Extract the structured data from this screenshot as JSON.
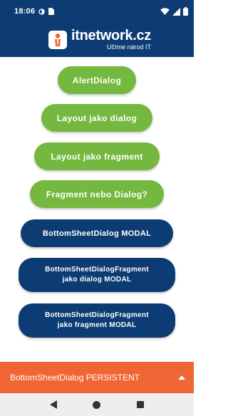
{
  "status_bar": {
    "time": "18:06",
    "icons": [
      "half-circle-icon",
      "sim-card-icon",
      "wifi-icon",
      "signal-icon",
      "battery-icon"
    ]
  },
  "app_bar": {
    "logo_name": "itnetwork.cz",
    "logo_tagline": "Učíme národ IT",
    "colors": {
      "background": "#0d3b73",
      "accent": "#ef6534"
    }
  },
  "buttons": [
    {
      "label": "AlertDialog"
    },
    {
      "label": "Layout jako dialog"
    },
    {
      "label": "Layout jako fragment"
    },
    {
      "label": "Fragment nebo Dialog?"
    },
    {
      "label": "BottomSheetDialog MODAL"
    },
    {
      "line1": "BottomSheetDialogFragment",
      "line2": "jako dialog MODAL"
    },
    {
      "line1": "BottomSheetDialogFragment",
      "line2": "jako fragment MODAL"
    }
  ],
  "button_colors": {
    "green": "#74b83f",
    "blue": "#0d3b73"
  },
  "bottom_sheet": {
    "label": "BottomSheetDialog PERSISTENT",
    "icon": "caret-up-icon",
    "color": "#ef6534"
  },
  "nav_bar": {
    "icons": [
      "back-icon",
      "home-icon",
      "recents-icon"
    ]
  }
}
